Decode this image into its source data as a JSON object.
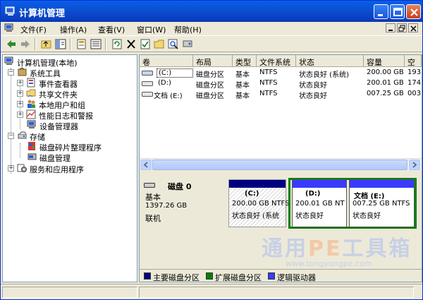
{
  "window": {
    "title": "计算机管理"
  },
  "menus": [
    "文件(F)",
    "操作(A)",
    "查看(V)",
    "窗口(W)",
    "帮助(H)"
  ],
  "tree": {
    "root": "计算机管理(本地)",
    "system_tools": "系统工具",
    "event_viewer": "事件查看器",
    "shared_folders": "共享文件夹",
    "local_users": "本地用户和组",
    "perf_logs": "性能日志和警报",
    "device_manager": "设备管理器",
    "storage": "存储",
    "defrag": "磁盘碎片整理程序",
    "disk_mgmt": "磁盘管理",
    "services": "服务和应用程序"
  },
  "list": {
    "columns": [
      "卷",
      "布局",
      "类型",
      "文件系统",
      "状态",
      "容量",
      "空"
    ],
    "rows": [
      {
        "vol": "(C:)",
        "layout": "磁盘分区",
        "type": "基本",
        "fs": "NTFS",
        "status": "状态良好 (系统)",
        "capacity": "200.00 GB",
        "free": "193"
      },
      {
        "vol": "(D:)",
        "layout": "磁盘分区",
        "type": "基本",
        "fs": "NTFS",
        "status": "状态良好",
        "capacity": "200.01 GB",
        "free": "174"
      },
      {
        "vol": "文档 (E:)",
        "layout": "磁盘分区",
        "type": "基本",
        "fs": "NTFS",
        "status": "状态良好",
        "capacity": "007.25 GB",
        "free": "003"
      }
    ]
  },
  "disk": {
    "name": "磁盘 0",
    "type": "基本",
    "size": "1397.26 GB",
    "state": "联机",
    "partitions": [
      {
        "label": "(C:)",
        "size": "200.00 GB NTFS",
        "status": "状态良好 (系统"
      },
      {
        "label": "(D:)",
        "size": "200.01 GB NT",
        "status": "状态良好"
      },
      {
        "label": "文档  (E:)",
        "size": "007.25 GB NTFS",
        "status": "状态良好"
      }
    ]
  },
  "legend": [
    {
      "label": "主要磁盘分区",
      "color": "#000080"
    },
    {
      "label": "扩展磁盘分区",
      "color": "#008000"
    },
    {
      "label": "逻辑驱动器",
      "color": "#3a3aff"
    }
  ],
  "watermark": {
    "main": "通用",
    "pe": "PE",
    "rest": "工具箱",
    "url": "www.tongyongpe.com"
  }
}
